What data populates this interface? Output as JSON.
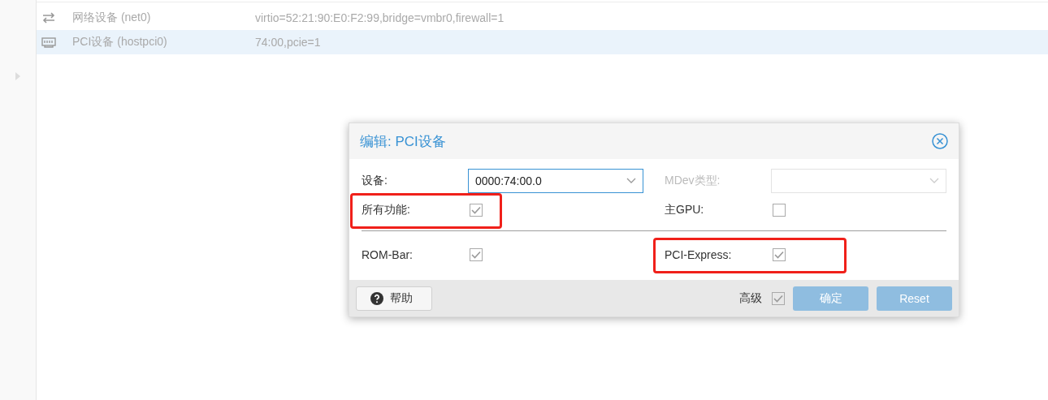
{
  "hardware_list": {
    "rows": [
      {
        "kind": "network",
        "name": "网络设备 (net0)",
        "value": "virtio=52:21:90:E0:F2:99,bridge=vmbr0,firewall=1",
        "selected": false
      },
      {
        "kind": "pci",
        "name": "PCI设备 (hostpci0)",
        "value": "74:00,pcie=1",
        "selected": true
      }
    ]
  },
  "dialog": {
    "title": "编辑: PCI设备",
    "sections": [
      {
        "fields": [
          {
            "kind": "select",
            "label": "设备:",
            "value": "0000:74:00.0",
            "disabled": false,
            "highlighted": false
          },
          {
            "kind": "select",
            "label": "MDev类型:",
            "disabled": true,
            "highlighted": false
          },
          {
            "kind": "checkbox",
            "label": "所有功能:",
            "checked": true,
            "highlighted": true
          },
          {
            "kind": "checkbox",
            "label": "主GPU:",
            "checked": false,
            "highlighted": false
          }
        ]
      },
      {
        "fields": [
          {
            "kind": "checkbox",
            "label": "ROM-Bar:",
            "checked": true,
            "highlighted": false
          },
          {
            "kind": "checkbox",
            "label": "PCI-Express:",
            "checked": true,
            "highlighted": true
          }
        ]
      }
    ],
    "help_button": "帮助",
    "advanced": {
      "label": "高级",
      "checked": true
    },
    "buttons": [
      {
        "label": "确定",
        "disabled": true
      },
      {
        "label": "Reset",
        "disabled": true
      }
    ]
  }
}
